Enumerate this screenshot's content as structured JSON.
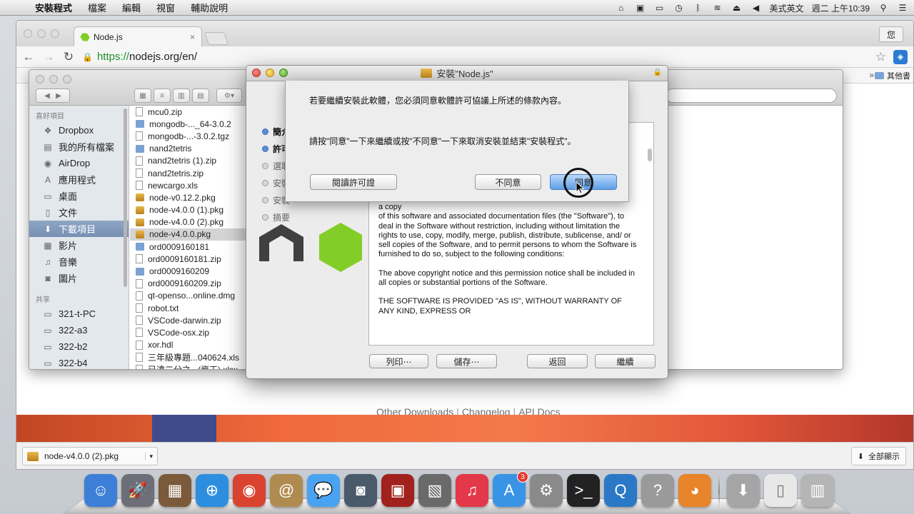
{
  "menubar": {
    "apple_symbol": "",
    "items": [
      "安裝程式",
      "檔案",
      "編輯",
      "視窗",
      "輔助說明"
    ],
    "input_method": "美式英文",
    "clock": "週二 上午10:39"
  },
  "browser": {
    "tab_title": "Node.js",
    "tab_close": "×",
    "profile_label": "您",
    "url_scheme": "https://",
    "url_host": "nodejs.org",
    "url_path": "/en/",
    "other_bookmarks": "其他書",
    "page_links": [
      "Other Downloads",
      "Changelog",
      "API Docs"
    ],
    "download_file": "node-v4.0.0 (2).pkg",
    "show_all": "全部顯示"
  },
  "finder": {
    "favorites_header": "喜好項目",
    "shared_header": "共享",
    "favorites": [
      {
        "label": "Dropbox",
        "icon": "dropbox-icon",
        "glyph": "❖"
      },
      {
        "label": "我的所有檔案",
        "icon": "all-files-icon",
        "glyph": "▤"
      },
      {
        "label": "AirDrop",
        "icon": "airdrop-icon",
        "glyph": "◉"
      },
      {
        "label": "應用程式",
        "icon": "applications-icon",
        "glyph": "A"
      },
      {
        "label": "桌面",
        "icon": "desktop-icon",
        "glyph": "▭"
      },
      {
        "label": "文件",
        "icon": "documents-icon",
        "glyph": "▯"
      },
      {
        "label": "下載項目",
        "icon": "downloads-icon",
        "glyph": "⬇",
        "selected": true
      },
      {
        "label": "影片",
        "icon": "movies-icon",
        "glyph": "▦"
      },
      {
        "label": "音樂",
        "icon": "music-icon",
        "glyph": "♫"
      },
      {
        "label": "圖片",
        "icon": "pictures-icon",
        "glyph": "◙"
      }
    ],
    "shared": [
      {
        "label": "321-t-PC",
        "icon": "computer-icon",
        "glyph": "▭"
      },
      {
        "label": "322-a3",
        "icon": "computer-icon",
        "glyph": "▭"
      },
      {
        "label": "322-b2",
        "icon": "computer-icon",
        "glyph": "▭"
      },
      {
        "label": "322-b4",
        "icon": "computer-icon",
        "glyph": "▭"
      }
    ],
    "files": [
      {
        "name": "mcu0.zip",
        "type": "file"
      },
      {
        "name": "mongodb-..._64-3.0.2",
        "type": "folder"
      },
      {
        "name": "mongodb-...-3.0.2.tgz",
        "type": "file"
      },
      {
        "name": "nand2tetris",
        "type": "folder"
      },
      {
        "name": "nand2tetris (1).zip",
        "type": "file"
      },
      {
        "name": "nand2tetris.zip",
        "type": "file"
      },
      {
        "name": "newcargo.xls",
        "type": "file"
      },
      {
        "name": "node-v0.12.2.pkg",
        "type": "pkg"
      },
      {
        "name": "node-v4.0.0 (1).pkg",
        "type": "pkg"
      },
      {
        "name": "node-v4.0.0 (2).pkg",
        "type": "pkg"
      },
      {
        "name": "node-v4.0.0.pkg",
        "type": "pkg",
        "selected": true
      },
      {
        "name": "ord0009160181",
        "type": "folder"
      },
      {
        "name": "ord0009160181.zip",
        "type": "file"
      },
      {
        "name": "ord0009160209",
        "type": "folder"
      },
      {
        "name": "ord0009160209.zip",
        "type": "file"
      },
      {
        "name": "qt-openso...online.dmg",
        "type": "file"
      },
      {
        "name": "robot.txt",
        "type": "file"
      },
      {
        "name": "VSCode-darwin.zip",
        "type": "file"
      },
      {
        "name": "VSCode-osx.zip",
        "type": "file"
      },
      {
        "name": "xor.hdl",
        "type": "file"
      },
      {
        "name": "三年級專題...040624.xls",
        "type": "file"
      },
      {
        "name": "已達二分之...(資工).xlsx",
        "type": "file"
      }
    ]
  },
  "installer": {
    "title": "安裝\"Node.js\"",
    "steps": [
      {
        "label": "簡介",
        "active": true
      },
      {
        "label": "許可",
        "active": true
      },
      {
        "label": "選取",
        "active": false
      },
      {
        "label": "安裝",
        "active": false
      },
      {
        "label": "安裝",
        "active": false
      },
      {
        "label": "摘要",
        "active": false
      }
    ],
    "license_paragraphs": [
      "a copy\nof this software and associated documentation files (the \"Software\"), to deal in the Software without restriction, including without limitation the rights to use, copy, modify, merge, publish, distribute, sublicense, and/ or\nsell copies of the Software, and to permit persons to whom the Software is\nfurnished to do so, subject to the following conditions:",
      "The above copyright notice and this permission notice shall be included in\nall copies or substantial portions of the Software.",
      "THE SOFTWARE IS PROVIDED \"AS IS\", WITHOUT WARRANTY OF ANY KIND, EXPRESS OR"
    ],
    "buttons": {
      "print": "列印⋯",
      "save": "儲存⋯",
      "back": "返回",
      "continue": "繼續"
    }
  },
  "sheet": {
    "message1": "若要繼續安裝此軟體，您必須同意軟體許可協議上所述的條款內容。",
    "message2": "請按\"同意\"一下來繼續或按\"不同意\"一下來取消安裝並結束\"安裝程式\"。",
    "read_license": "閱讀許可證",
    "disagree": "不同意",
    "agree": "同意"
  },
  "dock": {
    "apps": [
      {
        "name": "finder-icon",
        "glyph": "☺",
        "color": "#3d7fd6"
      },
      {
        "name": "launchpad-icon",
        "glyph": "🚀",
        "color": "#6e6e78"
      },
      {
        "name": "system-info-icon",
        "glyph": "▦",
        "color": "#7a5a3a"
      },
      {
        "name": "safari-icon",
        "glyph": "⊕",
        "color": "#2d8ee0"
      },
      {
        "name": "chrome-icon",
        "glyph": "◉",
        "color": "#d9432f"
      },
      {
        "name": "contacts-icon",
        "glyph": "@",
        "color": "#b08b4f"
      },
      {
        "name": "messages-icon",
        "glyph": "💬",
        "color": "#4aa3f0"
      },
      {
        "name": "facetime-icon",
        "glyph": "◙",
        "color": "#4a5a6a"
      },
      {
        "name": "photo-booth-icon",
        "glyph": "▣",
        "color": "#a1211d"
      },
      {
        "name": "iphoto-icon",
        "glyph": "▧",
        "color": "#6a6a6a"
      },
      {
        "name": "itunes-icon",
        "glyph": "♫",
        "color": "#e2384a"
      },
      {
        "name": "app-store-icon",
        "glyph": "A",
        "color": "#3a94e6",
        "badge": "3"
      },
      {
        "name": "system-preferences-icon",
        "glyph": "⚙",
        "color": "#8a8a8a"
      },
      {
        "name": "terminal-icon",
        "glyph": ">_",
        "color": "#222222"
      },
      {
        "name": "quicktime-icon",
        "glyph": "Q",
        "color": "#2b78c7"
      },
      {
        "name": "help-icon",
        "glyph": "?",
        "color": "#9a9a9a"
      },
      {
        "name": "blender-icon",
        "glyph": "◕",
        "color": "#e8842a"
      },
      {
        "name": "downloads-stack-icon",
        "glyph": "⬇",
        "color": "#a5a5a5"
      },
      {
        "name": "document-stack-icon",
        "glyph": "▯",
        "color": "#e8e8e8"
      },
      {
        "name": "trash-icon",
        "glyph": "▥",
        "color": "#b5b5b5"
      }
    ]
  }
}
